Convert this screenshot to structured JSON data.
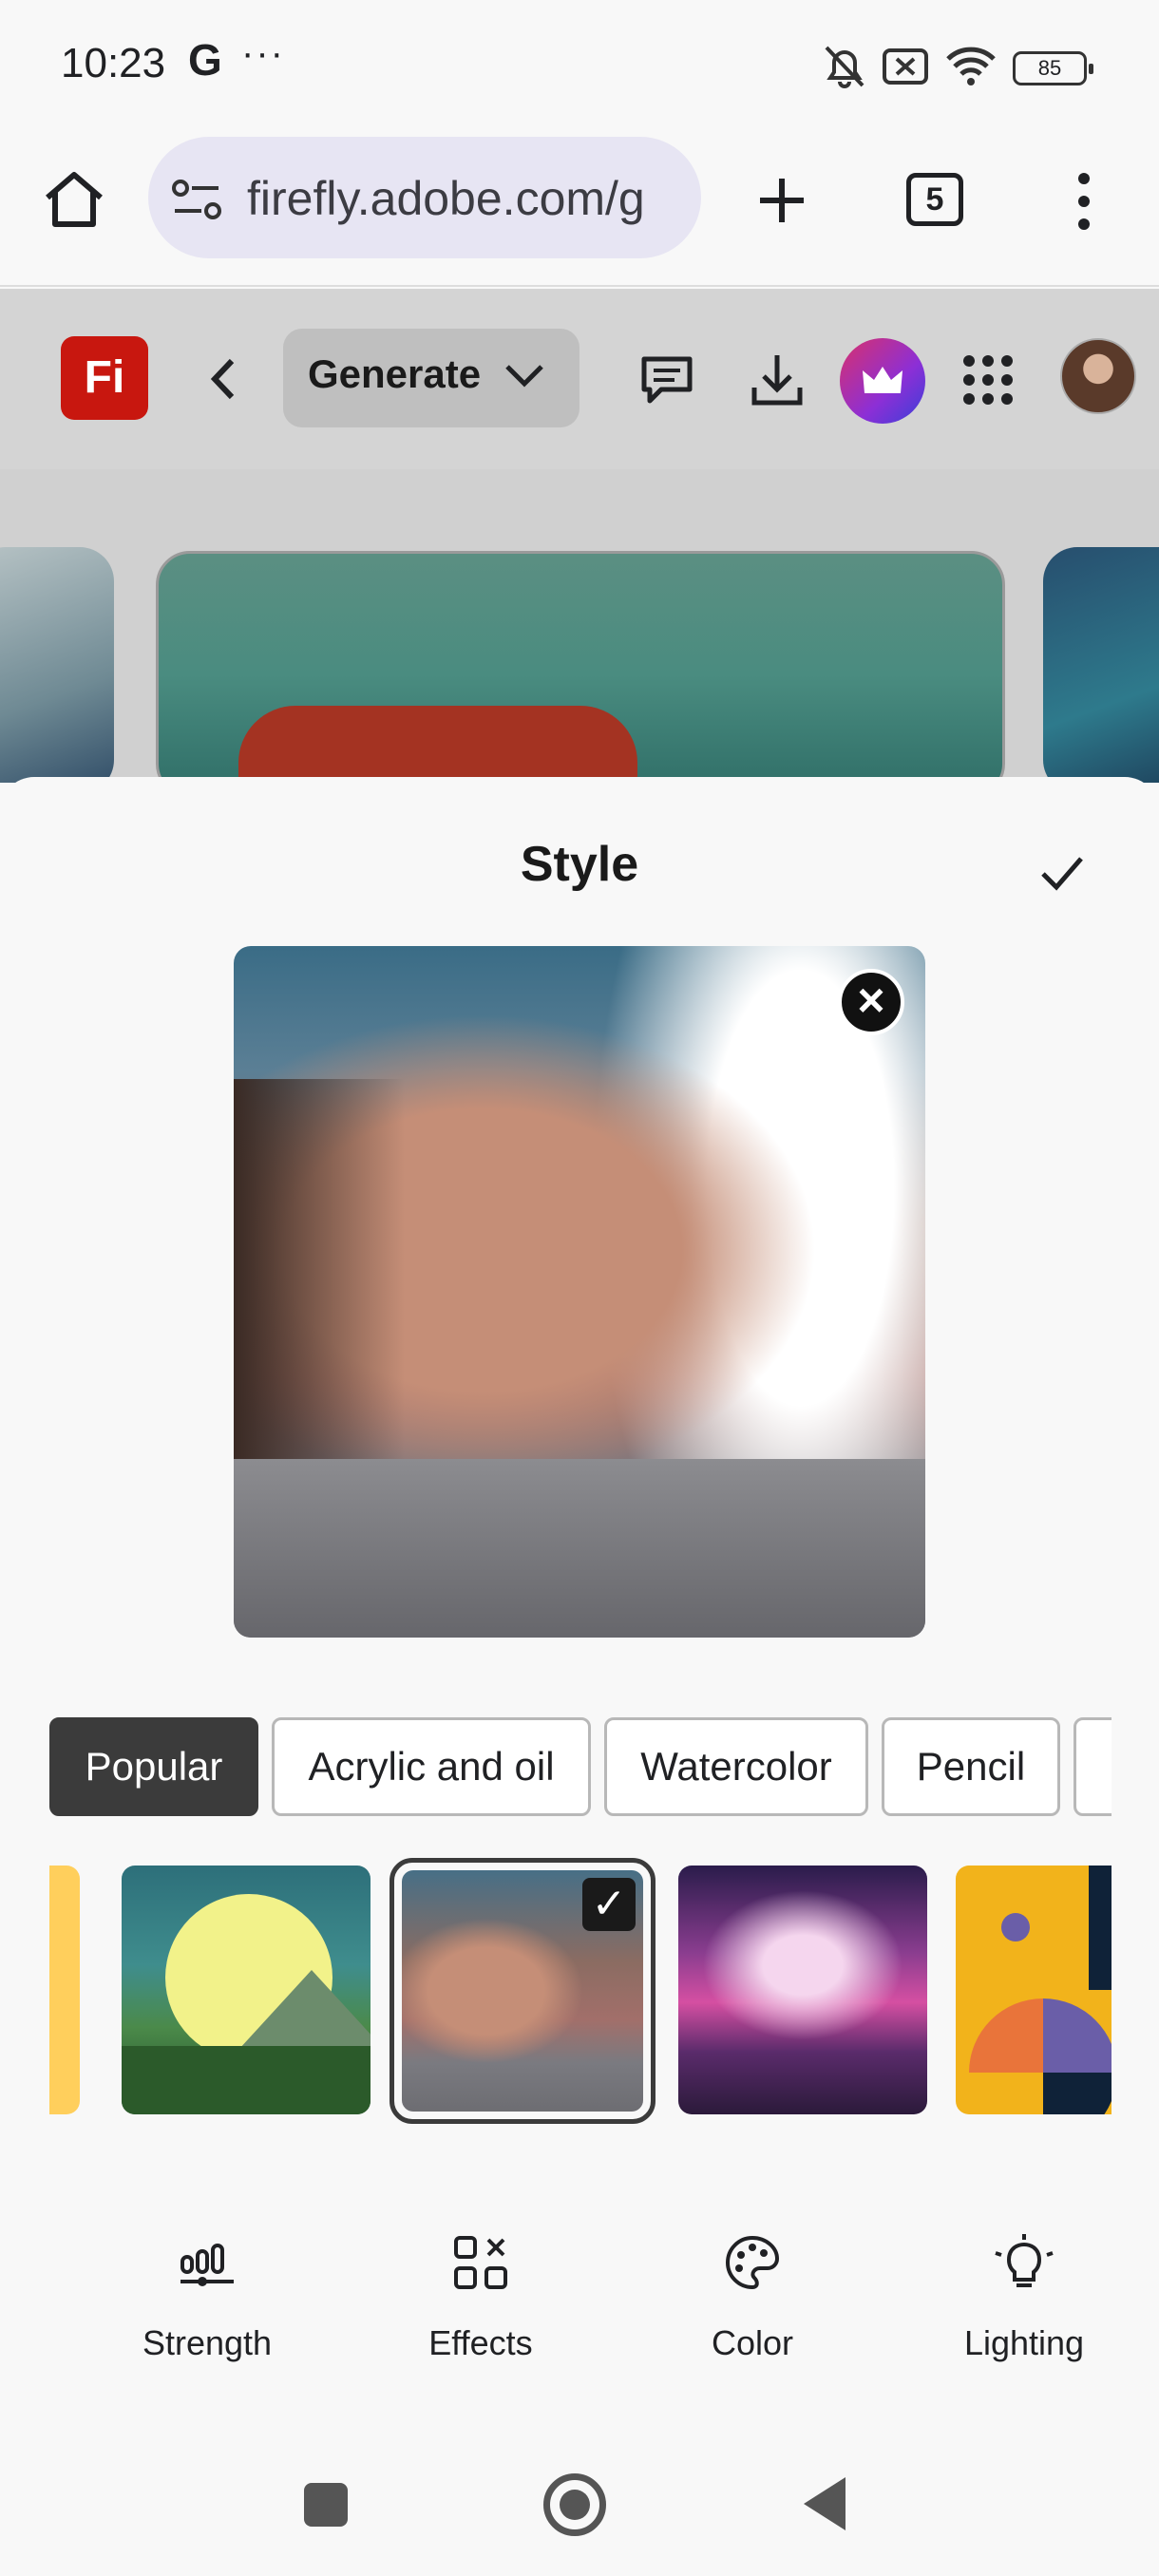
{
  "status_bar": {
    "time": "10:23",
    "google_badge": "G",
    "more": "···",
    "battery": "85"
  },
  "browser": {
    "url": "firefly.adobe.com/g",
    "tab_count": "5"
  },
  "app_header": {
    "app_badge": "Fi",
    "mode_label": "Generate"
  },
  "sheet": {
    "title": "Style",
    "categories": [
      {
        "label": "Popular",
        "active": true
      },
      {
        "label": "Acrylic and oil",
        "active": false
      },
      {
        "label": "Watercolor",
        "active": false
      },
      {
        "label": "Pencil",
        "active": false
      }
    ]
  },
  "tools": [
    {
      "label": "Strength",
      "icon": "strength-sliders-icon"
    },
    {
      "label": "Effects",
      "icon": "effects-grid-icon"
    },
    {
      "label": "Color",
      "icon": "palette-icon"
    },
    {
      "label": "Lighting",
      "icon": "lightbulb-icon"
    }
  ],
  "colors": {
    "accent_dark": "#3b3b3b",
    "brand_red": "#c8170f",
    "url_pill": "#e7e5f3"
  }
}
